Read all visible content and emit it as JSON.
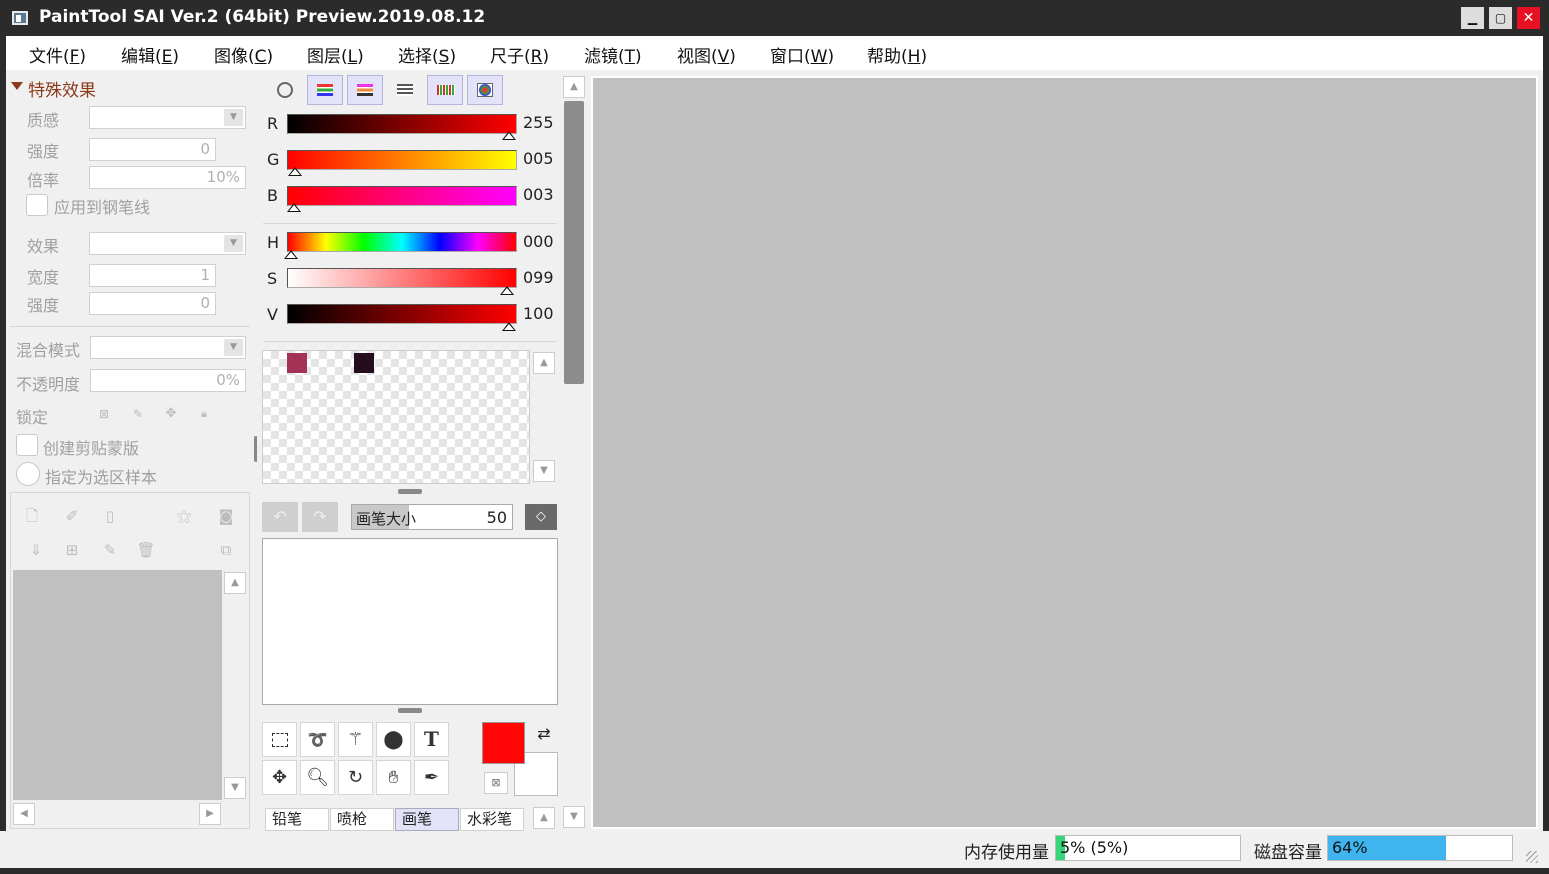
{
  "window": {
    "title": "PaintTool SAI Ver.2 (64bit) Preview.2019.08.12",
    "minimize_glyph": "▁",
    "maximize_glyph": "▢",
    "close_glyph": "✕"
  },
  "menu": [
    {
      "label": "文件(",
      "key": "F",
      "end": ")"
    },
    {
      "label": "编辑(",
      "key": "E",
      "end": ")"
    },
    {
      "label": "图像(",
      "key": "C",
      "end": ")"
    },
    {
      "label": "图层(",
      "key": "L",
      "end": ")"
    },
    {
      "label": "选择(",
      "key": "S",
      "end": ")"
    },
    {
      "label": "尺子(",
      "key": "R",
      "end": ")"
    },
    {
      "label": "滤镜(",
      "key": "T",
      "end": ")"
    },
    {
      "label": "视图(",
      "key": "V",
      "end": ")"
    },
    {
      "label": "窗口(",
      "key": "W",
      "end": ")"
    },
    {
      "label": "帮助(",
      "key": "H",
      "end": ")"
    }
  ],
  "effects": {
    "header": "特殊效果",
    "texture_label": "质感",
    "strength_label": "强度",
    "strength_value": "0",
    "scale_label": "倍率",
    "scale_value": "10%",
    "apply_pen_label": "应用到钢笔线",
    "effect_label": "效果",
    "width_label": "宽度",
    "width_value": "1",
    "strength2_label": "强度",
    "strength2_value": "0"
  },
  "layer": {
    "blend_label": "混合模式",
    "opacity_label": "不透明度",
    "opacity_value": "0%",
    "lock_label": "锁定",
    "clip_label": "创建剪贴蒙版",
    "selection_sample_label": "指定为选区样本"
  },
  "color": {
    "r_label": "R",
    "r_value": "255",
    "r_level": 1.0,
    "g_label": "G",
    "g_value": "005",
    "g_level": 0.02,
    "b_label": "B",
    "b_value": "003",
    "b_level": 0.012,
    "h_label": "H",
    "h_value": "000",
    "h_level": 0.0,
    "s_label": "S",
    "s_value": "099",
    "s_level": 0.99,
    "v_label": "V",
    "v_value": "100",
    "v_level": 1.0,
    "foreground": "#ff0505",
    "background": "#ffffff",
    "swatches": [
      "#a33256",
      "#230d1f"
    ]
  },
  "brush": {
    "size_label": "画笔大小",
    "size_value": "50"
  },
  "tools": {
    "text_tool_glyph": "T"
  },
  "brush_tabs": [
    "铅笔",
    "喷枪",
    "画笔",
    "水彩笔"
  ],
  "status": {
    "memory_label": "内存使用量",
    "memory_value": "5% (5%)",
    "memory_level": 0.05,
    "disk_label": "磁盘容量",
    "disk_value": "64%",
    "disk_level": 0.64
  }
}
